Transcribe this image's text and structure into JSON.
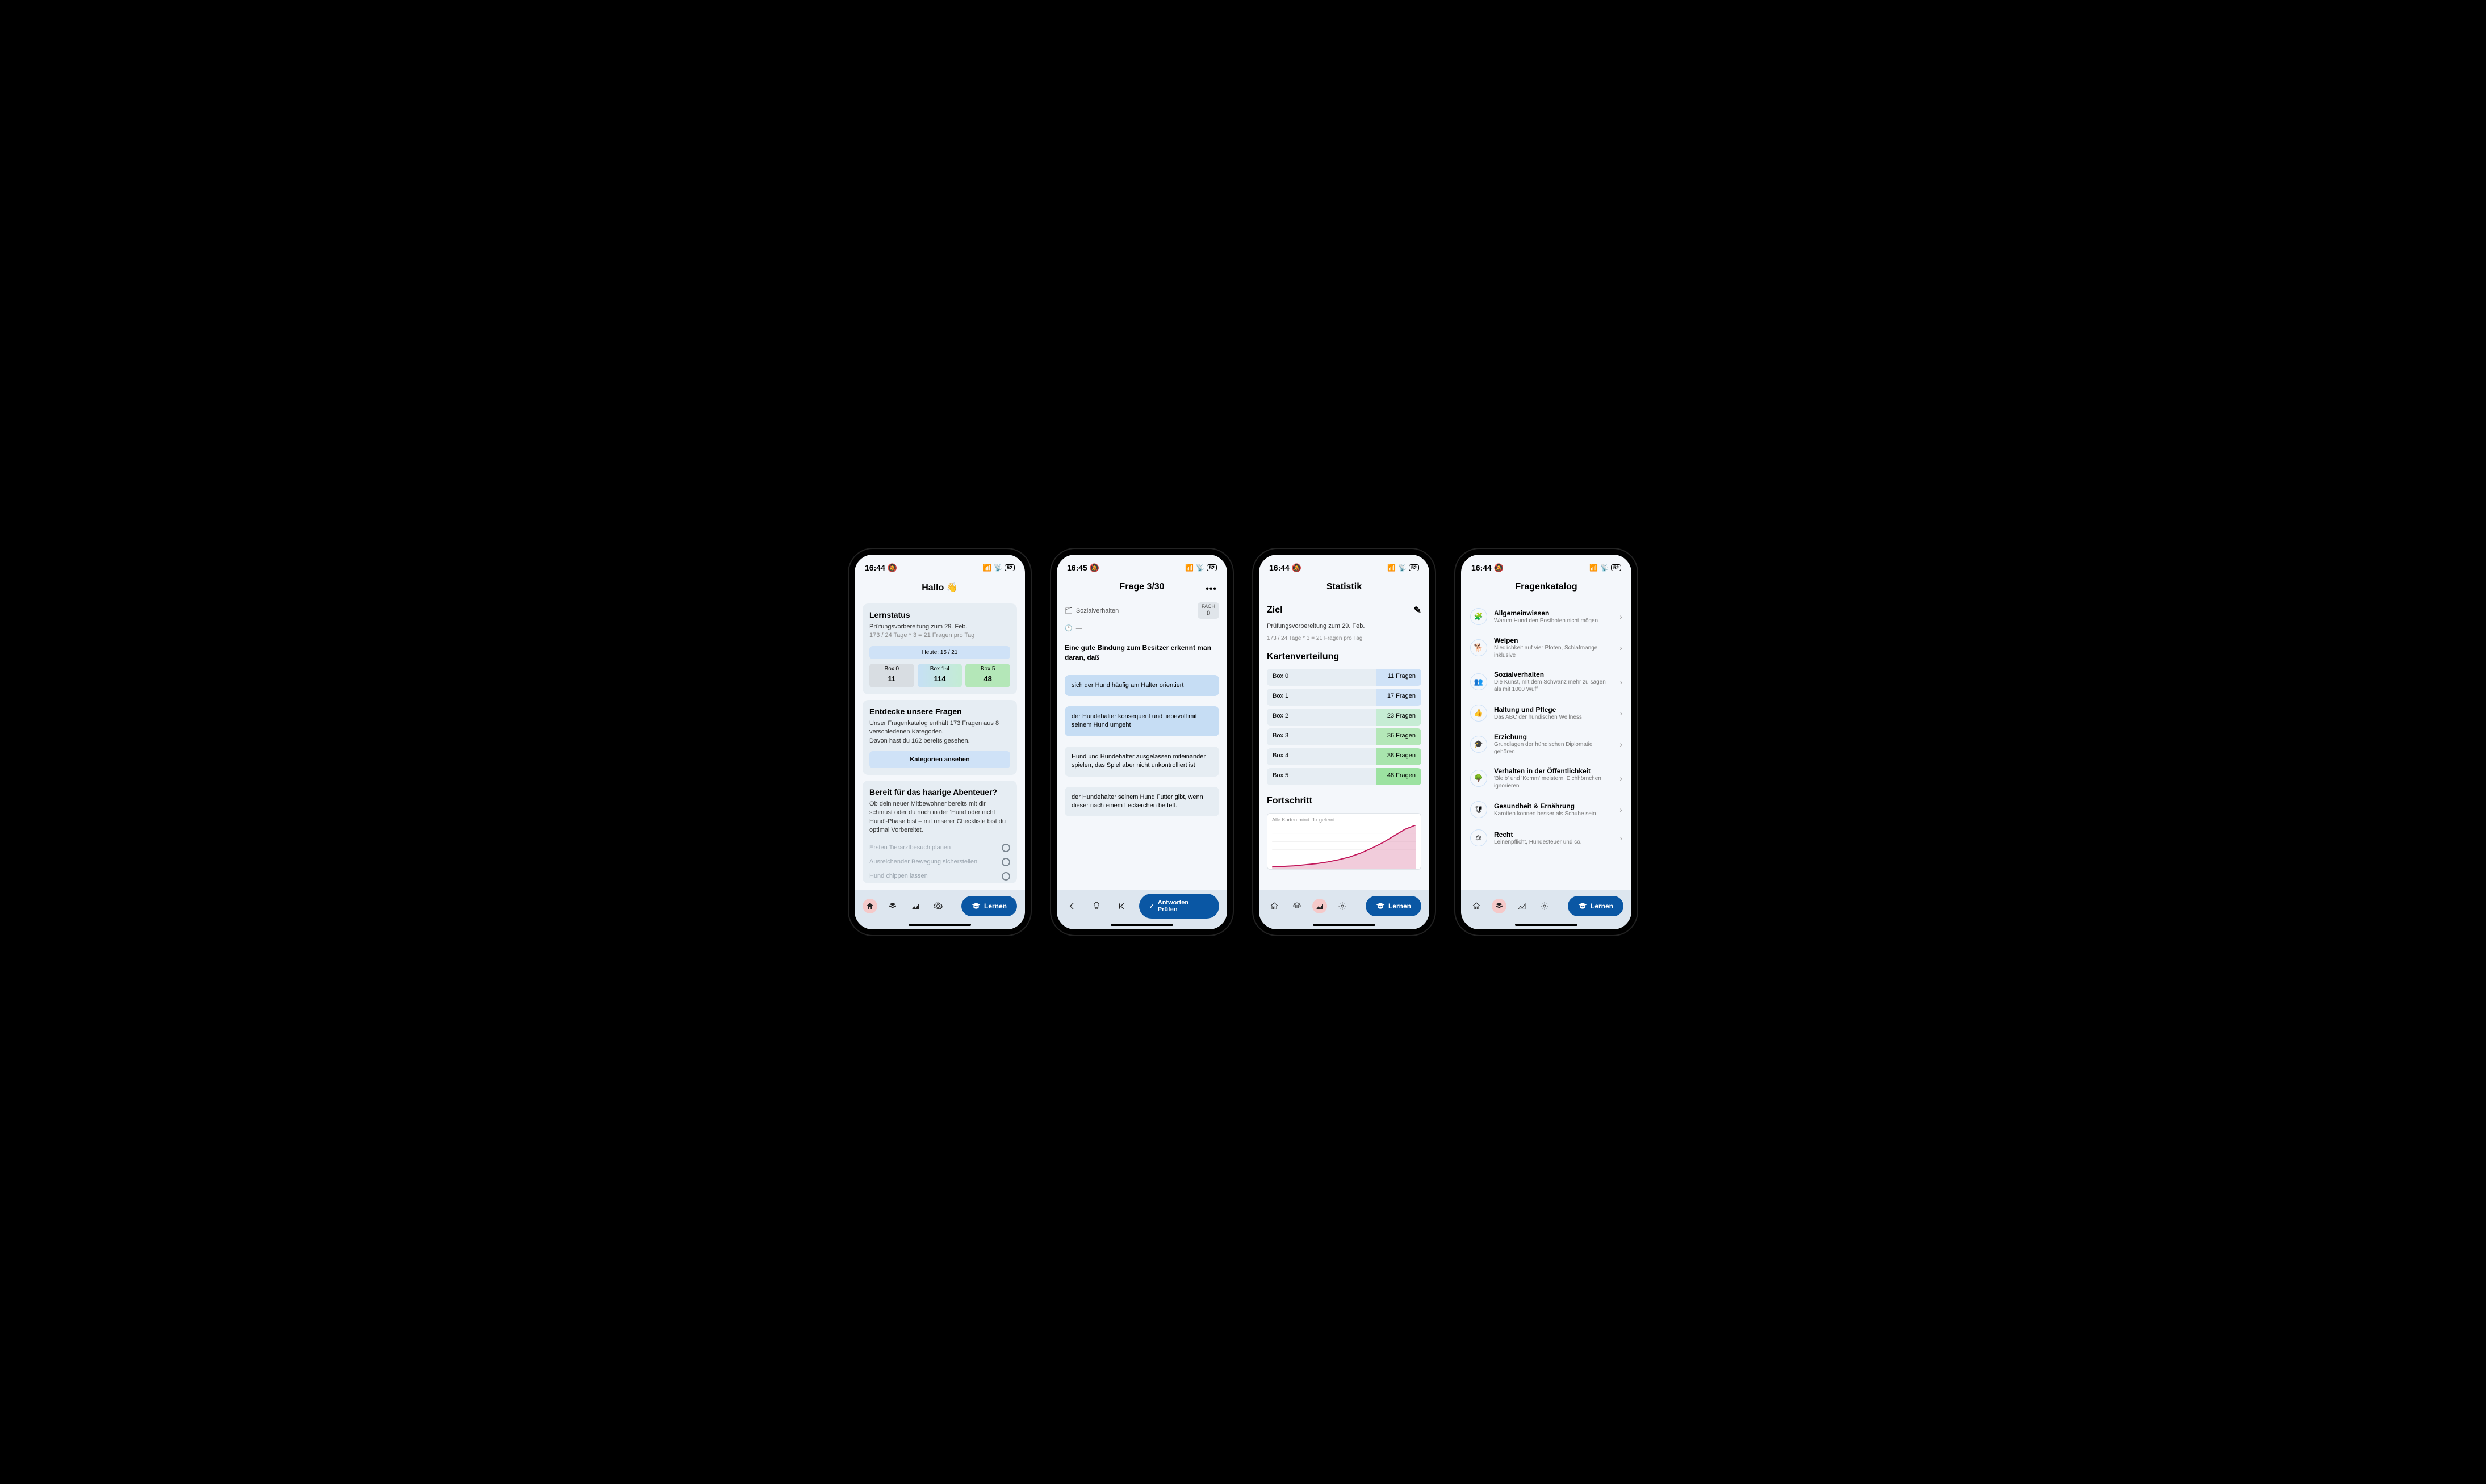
{
  "status": {
    "time": "16:44",
    "time2": "16:45",
    "battery": "52"
  },
  "screen1": {
    "title": "Hallo 👋",
    "lernstatus": {
      "heading": "Lernstatus",
      "sub": "Prüfungsvorbereitung zum 29. Feb.",
      "formula": "173 / 24 Tage * 3 = 21 Fragen pro Tag",
      "today": "Heute: 15 / 21",
      "boxes": [
        {
          "label": "Box 0",
          "count": "11"
        },
        {
          "label": "Box 1-4",
          "count": "114"
        },
        {
          "label": "Box 5",
          "count": "48"
        }
      ]
    },
    "discover": {
      "heading": "Entdecke unsere Fragen",
      "line1": "Unser Fragenkatalog enthält 173 Fragen aus 8 verschiedenen Kategorien.",
      "line2": "Davon hast du 162 bereits gesehen.",
      "button": "Kategorien ansehen"
    },
    "adventure": {
      "heading": "Bereit für das haarige Abenteuer?",
      "body": "Ob dein neuer Mitbewohner bereits mit dir schmust oder du noch in der 'Hund oder nicht Hund'-Phase bist – mit unserer Checkliste bist du optimal Vorbereitet.",
      "items": [
        "Ersten Tierarztbesuch planen",
        "Ausreichender Bewegung sicherstellen",
        "Hund chippen lassen"
      ]
    },
    "learn_label": "Lernen"
  },
  "screen2": {
    "title": "Frage 3/30",
    "category": "Sozialverhalten",
    "time_dash": "—",
    "fach_label": "FACH",
    "fach_num": "0",
    "question": "Eine gute Bindung zum Besitzer erkennt man daran, daß",
    "answers": [
      {
        "text": "sich der Hund häufig am Halter orientiert",
        "sel": true
      },
      {
        "text": "der Hundehalter konsequent und liebevoll mit seinem Hund umgeht",
        "sel": true
      },
      {
        "text": "Hund und Hundehalter ausgelassen miteinander spielen, das Spiel aber nicht unkontrolliert ist",
        "sel": false
      },
      {
        "text": "der Hundehalter seinem Hund Futter gibt, wenn dieser nach einem Leckerchen bettelt.",
        "sel": false
      }
    ],
    "check_label": "Antworten Prüfen"
  },
  "screen3": {
    "title": "Statistik",
    "goal_h": "Ziel",
    "goal_sub": "Prüfungsvorbereitung zum 29. Feb.",
    "goal_formula": "173 / 24 Tage * 3 = 21 Fragen pro Tag",
    "dist_h": "Kartenverteilung",
    "dist": [
      {
        "label": "Box 0",
        "val": "11 Fragen",
        "cls": "g1"
      },
      {
        "label": "Box 1",
        "val": "17 Fragen",
        "cls": "g1"
      },
      {
        "label": "Box 2",
        "val": "23 Fragen",
        "cls": "g2"
      },
      {
        "label": "Box 3",
        "val": "36 Fragen",
        "cls": "g3"
      },
      {
        "label": "Box 4",
        "val": "38 Fragen",
        "cls": "g4"
      },
      {
        "label": "Box 5",
        "val": "48 Fragen",
        "cls": "g5"
      }
    ],
    "progress_h": "Fortschritt",
    "chart_label": "Alle Karten mind. 1x gelernt",
    "learn_label": "Lernen"
  },
  "screen4": {
    "title": "Fragenkatalog",
    "cats": [
      {
        "title": "Allgemeinwissen",
        "sub": "Warum Hund den Postboten nicht mögen"
      },
      {
        "title": "Welpen",
        "sub": "Niedlichkeit auf vier Pfoten, Schlafmangel inklusive"
      },
      {
        "title": "Sozialverhalten",
        "sub": "Die Kunst, mit dem Schwanz mehr zu sagen als mit 1000 Wuff"
      },
      {
        "title": "Haltung und Pflege",
        "sub": "Das ABC der hündischen Wellness"
      },
      {
        "title": "Erziehung",
        "sub": "Grundlagen der hündischen Diplomatie gehören"
      },
      {
        "title": "Verhalten in der Öffentlichkeit",
        "sub": "'Bleib' und 'Komm' meistern, Eichhörnchen ignorieren"
      },
      {
        "title": "Gesundheit & Ernährung",
        "sub": "Karotten können besser als Schuhe sein"
      },
      {
        "title": "Recht",
        "sub": "Leinenpflicht, Hundesteuer und co."
      }
    ],
    "learn_label": "Lernen"
  },
  "chart_data": {
    "type": "area",
    "title": "Alle Karten mind. 1x gelernt",
    "x": [
      0,
      1,
      2,
      3,
      4,
      5,
      6,
      7,
      8,
      9,
      10,
      11,
      12,
      13,
      14
    ],
    "values": [
      5,
      7,
      9,
      11,
      14,
      18,
      22,
      27,
      33,
      41,
      51,
      64,
      80,
      100,
      125
    ],
    "xlabel": "",
    "ylabel": "",
    "ylim": [
      0,
      130
    ]
  }
}
